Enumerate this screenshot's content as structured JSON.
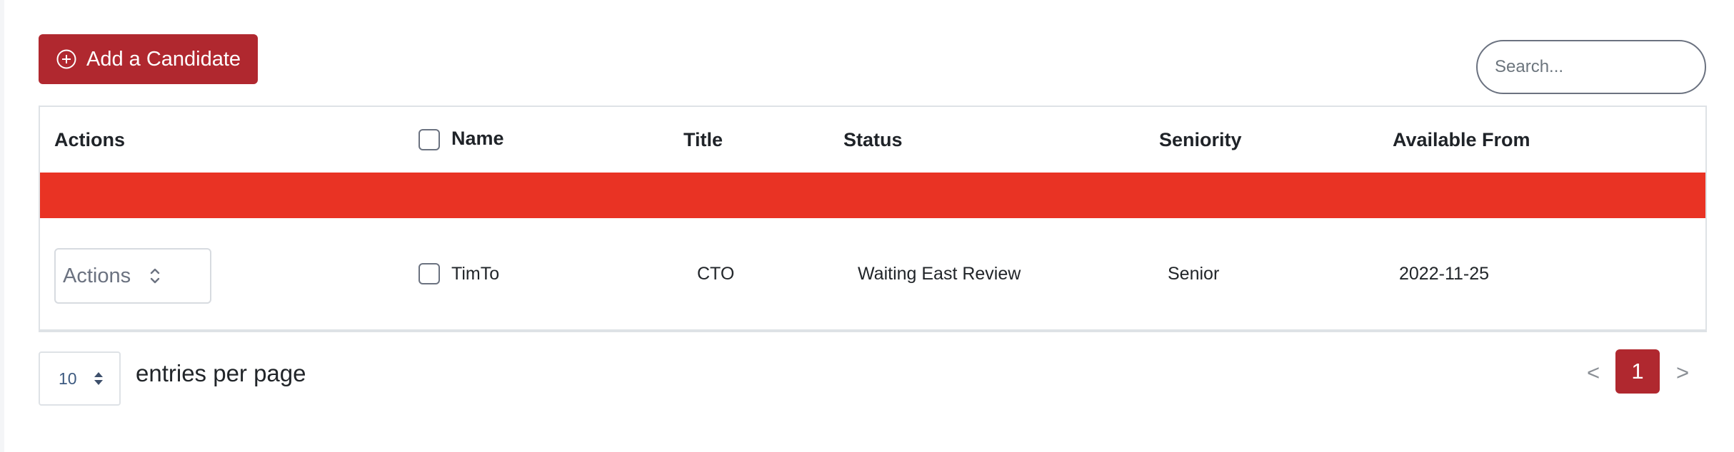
{
  "toolbar": {
    "add_label": "Add a Candidate",
    "search_placeholder": "Search...",
    "search_value": ""
  },
  "table": {
    "columns": {
      "actions": "Actions",
      "name": "Name",
      "title": "Title",
      "status": "Status",
      "seniority": "Seniority",
      "available_from": "Available From"
    },
    "rows": [
      {
        "actions_label": "Actions",
        "name": "TimTo",
        "title": "CTO",
        "status": "Waiting East Review",
        "seniority": "Senior",
        "available_from": "2022-11-25"
      }
    ]
  },
  "footer": {
    "per_page_value": "10",
    "per_page_label": "entries per page",
    "prev_label": "<",
    "current_page": "1",
    "next_label": ">"
  },
  "colors": {
    "accent": "#b0282f",
    "highlight_band": "#e93324"
  },
  "icons": {
    "add": "plus-circle-icon",
    "actions_select": "chevrons-up-down-icon",
    "per_page_select": "sort-icon"
  }
}
